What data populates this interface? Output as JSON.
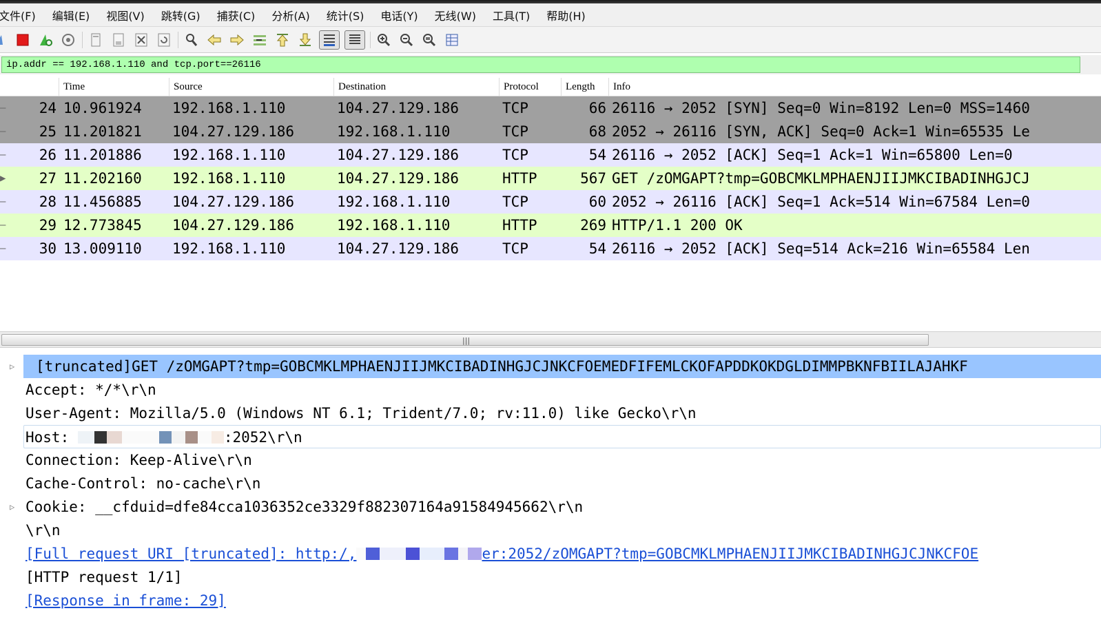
{
  "menu": [
    "文件(F)",
    "编辑(E)",
    "视图(V)",
    "跳转(G)",
    "捕获(C)",
    "分析(A)",
    "统计(S)",
    "电话(Y)",
    "无线(W)",
    "工具(T)",
    "帮助(H)"
  ],
  "filter": {
    "value": "ip.addr == 192.168.1.110 and tcp.port==26116"
  },
  "columns": {
    "no": "",
    "time": "Time",
    "source": "Source",
    "destination": "Destination",
    "protocol": "Protocol",
    "length": "Length",
    "info": "Info"
  },
  "packets": [
    {
      "no": "24",
      "time": "10.961924",
      "source": "192.168.1.110",
      "destination": "104.27.129.186",
      "protocol": "TCP",
      "length": "66",
      "info": "26116 → 2052 [SYN] Seq=0 Win=8192 Len=0 MSS=1460"
    },
    {
      "no": "25",
      "time": "11.201821",
      "source": "104.27.129.186",
      "destination": "192.168.1.110",
      "protocol": "TCP",
      "length": "68",
      "info": "2052 → 26116 [SYN, ACK] Seq=0 Ack=1 Win=65535 Le"
    },
    {
      "no": "26",
      "time": "11.201886",
      "source": "192.168.1.110",
      "destination": "104.27.129.186",
      "protocol": "TCP",
      "length": "54",
      "info": "26116 → 2052 [ACK] Seq=1 Ack=1 Win=65800 Len=0"
    },
    {
      "no": "27",
      "time": "11.202160",
      "source": "192.168.1.110",
      "destination": "104.27.129.186",
      "protocol": "HTTP",
      "length": "567",
      "info": "GET /zOMGAPT?tmp=GOBCMKLMPHAENJIIJMKCIBADINHGJCJ"
    },
    {
      "no": "28",
      "time": "11.456885",
      "source": "104.27.129.186",
      "destination": "192.168.1.110",
      "protocol": "TCP",
      "length": "60",
      "info": "2052 → 26116 [ACK] Seq=1 Ack=514 Win=67584 Len=0"
    },
    {
      "no": "29",
      "time": "12.773845",
      "source": "104.27.129.186",
      "destination": "192.168.1.110",
      "protocol": "HTTP",
      "length": "269",
      "info": "HTTP/1.1 200 OK"
    },
    {
      "no": "30",
      "time": "13.009110",
      "source": "192.168.1.110",
      "destination": "104.27.129.186",
      "protocol": "TCP",
      "length": "54",
      "info": "26116 → 2052 [ACK] Seq=514 Ack=216 Win=65584 Len"
    }
  ],
  "details": {
    "request_line": "[truncated]GET /zOMGAPT?tmp=GOBCMKLMPHAENJIIJMKCIBADINHGJCJNKCFOEMEDFIFEMLCKOFAPDDKOKDGLDIMMPBKNFBIILAJAHKF",
    "accept": "Accept: */*\\r\\n",
    "user_agent": "User-Agent: Mozilla/5.0 (Windows NT 6.1; Trident/7.0; rv:11.0) like Gecko\\r\\n",
    "host_label": "Host: ",
    "host_suffix": ":2052\\r\\n",
    "connection": "Connection: Keep-Alive\\r\\n",
    "cache_control": "Cache-Control: no-cache\\r\\n",
    "cookie": "Cookie: __cfduid=dfe84cca1036352ce3329f882307164a91584945662\\r\\n",
    "crlf": "\\r\\n",
    "full_uri_prefix": "[Full request URI [truncated]: http:/,",
    "full_uri_suffix": "er:2052/zOMGAPT?tmp=GOBCMKLMPHAENJIIJMKCIBADINHGJCJNKCFOE",
    "request_num": "[HTTP request 1/1]",
    "response_in": "[Response in frame: 29]"
  },
  "colors": {
    "tcp_handshake_bg": "#a0a0a0",
    "tcp_bg": "#e7e6ff",
    "http_bg": "#e4ffc7",
    "filter_bg": "#afffaf",
    "selected_bg": "#99c5ff",
    "link": "#1a4fd6"
  }
}
